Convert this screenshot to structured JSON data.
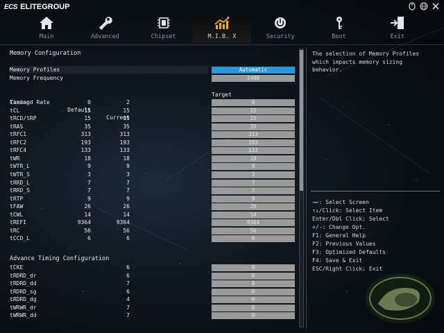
{
  "brand": {
    "logo": "ECS",
    "name": "ELITEGROUP"
  },
  "tabs": [
    {
      "label": "Main",
      "icon": "home-icon",
      "active": false
    },
    {
      "label": "Advanced",
      "icon": "wrench-icon",
      "active": false
    },
    {
      "label": "Chipset",
      "icon": "chip-icon",
      "active": false
    },
    {
      "label": "M.I.B. X",
      "icon": "chart-icon",
      "active": true
    },
    {
      "label": "Security",
      "icon": "power-lock-icon",
      "active": false
    },
    {
      "label": "Boot",
      "icon": "key-icon",
      "active": false
    },
    {
      "label": "Exit",
      "icon": "exit-icon",
      "active": false
    }
  ],
  "section": {
    "title": "Memory Configuration",
    "profiles_label": "Memory Profiles",
    "profiles_value": "Automatic",
    "frequency_label": "Memory Frequency",
    "frequency_value": "2400"
  },
  "timing_table": {
    "headers": {
      "name": "Timing",
      "default": "Default",
      "current": "Current",
      "target": "Target"
    },
    "rows": [
      {
        "name": "Command Rate",
        "default": "0",
        "current": "2",
        "target": "0"
      },
      {
        "name": "tCL",
        "default": "15",
        "current": "15",
        "target": "15"
      },
      {
        "name": "tRCD/tRP",
        "default": "15",
        "current": "15",
        "target": "15"
      },
      {
        "name": "tRAS",
        "default": "35",
        "current": "35",
        "target": "35"
      },
      {
        "name": "tRFC1",
        "default": "313",
        "current": "313",
        "target": "313"
      },
      {
        "name": "tRFC2",
        "default": "193",
        "current": "193",
        "target": "193"
      },
      {
        "name": "tRFC4",
        "default": "133",
        "current": "133",
        "target": "133"
      },
      {
        "name": "tWR",
        "default": "18",
        "current": "18",
        "target": "18"
      },
      {
        "name": "tWTR_L",
        "default": "9",
        "current": "9",
        "target": "9"
      },
      {
        "name": "tWTR_S",
        "default": "3",
        "current": "3",
        "target": "3"
      },
      {
        "name": "tRRD_L",
        "default": "7",
        "current": "7",
        "target": "7"
      },
      {
        "name": "tRRD_S",
        "default": "7",
        "current": "7",
        "target": "7"
      },
      {
        "name": "tRTP",
        "default": "9",
        "current": "9",
        "target": "9"
      },
      {
        "name": "tFAW",
        "default": "26",
        "current": "26",
        "target": "26"
      },
      {
        "name": "tCWL",
        "default": "14",
        "current": "14",
        "target": "14"
      },
      {
        "name": "tREFI",
        "default": "9364",
        "current": "9364",
        "target": "9364"
      },
      {
        "name": "tRC",
        "default": "56",
        "current": "56",
        "target": "56"
      },
      {
        "name": "tCCD_L",
        "default": "6",
        "current": "6",
        "target": "6"
      }
    ]
  },
  "advance": {
    "title": "Advance Timing Configuration",
    "rows": [
      {
        "name": "tCKE",
        "current": "6",
        "target": "0"
      },
      {
        "name": "tRDRD_dr",
        "current": "6",
        "target": "0"
      },
      {
        "name": "tRDRD_dd",
        "current": "7",
        "target": "0"
      },
      {
        "name": "tRDRD_sg",
        "current": "6",
        "target": "0"
      },
      {
        "name": "tRDRD_dg",
        "current": "4",
        "target": "0"
      },
      {
        "name": "tWRWR_dr",
        "current": "7",
        "target": "0"
      },
      {
        "name": "tWRWR_dd",
        "current": "7",
        "target": "0"
      }
    ]
  },
  "help_text": "The selection of Memory Profiles\nwhich impacts memory sizing\nbehavior.",
  "keys": [
    "→←: Select Screen",
    "↑↓/Click: Select Item",
    "Enter/Dbl Click: Select",
    "+/-: Change Opt.",
    "F1: General Help",
    "F2: Previous Values",
    "F3: Optimized Defaults",
    "F4: Save & Exit",
    "ESC/Right Click: Exit"
  ],
  "colors": {
    "selected_box": "#2a98d8",
    "box": "#9a9a9a",
    "active_tab_icon": "#f0b020"
  }
}
